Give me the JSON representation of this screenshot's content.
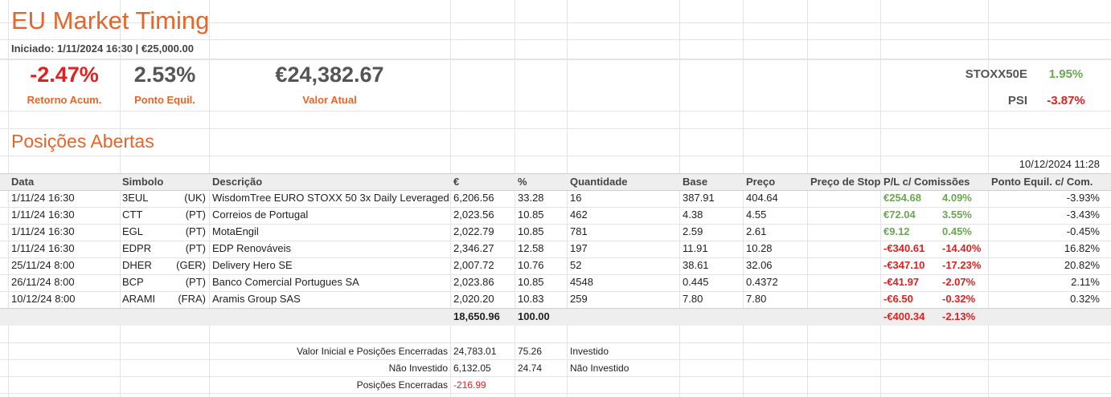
{
  "title": "EU Market Timing",
  "subtitle": "Iniciado: 1/11/2024 16:30 | €25,000.00",
  "kpis": [
    {
      "value": "-2.47%",
      "label": "Retorno Acum."
    },
    {
      "value": "2.53%",
      "label": "Ponto Equil."
    },
    {
      "value": "€24,382.67",
      "label": "Valor Atual"
    }
  ],
  "indices": [
    {
      "name": "STOXX50E",
      "value": "1.95%"
    },
    {
      "name": "PSI",
      "value": "-3.87%"
    }
  ],
  "section_title": "Posições Abertas",
  "timestamp": "10/12/2024 11:28",
  "columns": [
    "Data",
    "Simbolo",
    "Descrição",
    "€",
    "%",
    "Quantidade",
    "Base",
    "Preço",
    "Preço de Stop",
    "P/L c/ Comissões",
    "Ponto Equil. c/ Com."
  ],
  "rows": [
    {
      "date": "1/11/24 16:30",
      "symbol": "3EUL",
      "exch": "(UK)",
      "desc": "WisdomTree EURO STOXX 50 3x Daily Leveraged",
      "eur": "6,206.56",
      "pct": "33.28",
      "qty": "16",
      "base": "387.91",
      "price": "404.64",
      "stop": "",
      "pl": "€254.68",
      "plpct": "4.09%",
      "be": "-3.93%",
      "positive": true
    },
    {
      "date": "1/11/24 16:30",
      "symbol": "CTT",
      "exch": "(PT)",
      "desc": "Correios de Portugal",
      "eur": "2,023.56",
      "pct": "10.85",
      "qty": "462",
      "base": "4.38",
      "price": "4.55",
      "stop": "",
      "pl": "€72.04",
      "plpct": "3.55%",
      "be": "-3.43%",
      "positive": true
    },
    {
      "date": "1/11/24 16:30",
      "symbol": "EGL",
      "exch": "(PT)",
      "desc": "MotaEngil",
      "eur": "2,022.79",
      "pct": "10.85",
      "qty": "781",
      "base": "2.59",
      "price": "2.61",
      "stop": "",
      "pl": "€9.12",
      "plpct": "0.45%",
      "be": "-0.45%",
      "positive": true
    },
    {
      "date": "1/11/24 16:30",
      "symbol": "EDPR",
      "exch": "(PT)",
      "desc": "EDP Renováveis",
      "eur": "2,346.27",
      "pct": "12.58",
      "qty": "197",
      "base": "11.91",
      "price": "10.28",
      "stop": "",
      "pl": "-€340.61",
      "plpct": "-14.40%",
      "be": "16.82%",
      "positive": false
    },
    {
      "date": "25/11/24 8:00",
      "symbol": "DHER",
      "exch": "(GER)",
      "desc": "Delivery Hero SE",
      "eur": "2,007.72",
      "pct": "10.76",
      "qty": "52",
      "base": "38.61",
      "price": "32.06",
      "stop": "",
      "pl": "-€347.10",
      "plpct": "-17.23%",
      "be": "20.82%",
      "positive": false
    },
    {
      "date": "26/11/24 8:00",
      "symbol": "BCP",
      "exch": "(PT)",
      "desc": "Banco Comercial Portugues SA",
      "eur": "2,023.86",
      "pct": "10.85",
      "qty": "4548",
      "base": "0.445",
      "price": "0.4372",
      "stop": "",
      "pl": "-€41.97",
      "plpct": "-2.07%",
      "be": "2.11%",
      "positive": false
    },
    {
      "date": "10/12/24 8:00",
      "symbol": "ARAMI",
      "exch": "(FRA)",
      "desc": "Aramis Group SAS",
      "eur": "2,020.20",
      "pct": "10.83",
      "qty": "259",
      "base": "7.80",
      "price": "7.80",
      "stop": "",
      "pl": "-€6.50",
      "plpct": "-0.32%",
      "be": "0.32%",
      "positive": false
    }
  ],
  "totals": {
    "eur": "18,650.96",
    "pct": "100.00",
    "pl": "-€400.34",
    "plpct": "-2.13%"
  },
  "summary": [
    {
      "label": "Valor Inicial e Posições Encerradas",
      "value": "24,783.01",
      "pct": "75.26",
      "tag": "Investido"
    },
    {
      "label": "Não Investido",
      "value": "6,132.05",
      "pct": "24.74",
      "tag": "Não Investido"
    },
    {
      "label": "Posições Encerradas",
      "value": "-216.99",
      "pct": "",
      "tag": ""
    }
  ]
}
